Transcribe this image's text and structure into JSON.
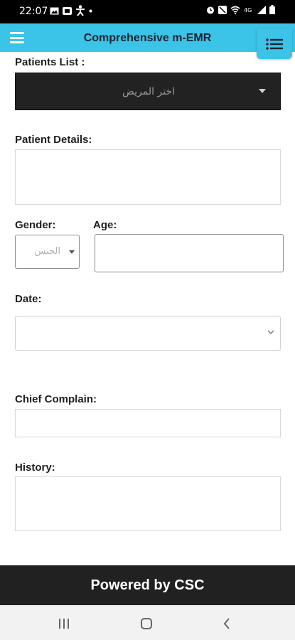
{
  "status_bar": {
    "time": "22:07",
    "icons": [
      "gallery-icon",
      "notification-icon",
      "accessibility-icon",
      "dot-icon",
      "alarm-icon",
      "mute-icon",
      "wifi-icon",
      "volte-icon",
      "signal-icon",
      "battery-icon"
    ]
  },
  "app_bar": {
    "title": "Comprehensive m-EMR",
    "color": "#3cc3e8"
  },
  "form": {
    "patients_list_label": "Patients List :",
    "patients_select_value": "اختر المريض",
    "patient_details_label": "Patient Details:",
    "gender_label": "Gender:",
    "gender_value": "الجنس",
    "age_label": "Age:",
    "date_label": "Date:",
    "chief_complain_label": "Chief Complain:",
    "history_label": "History:"
  },
  "footer": {
    "text": "Powered by CSC"
  },
  "nav_bar": {
    "buttons": [
      "recents-icon",
      "home-icon",
      "back-icon"
    ]
  }
}
